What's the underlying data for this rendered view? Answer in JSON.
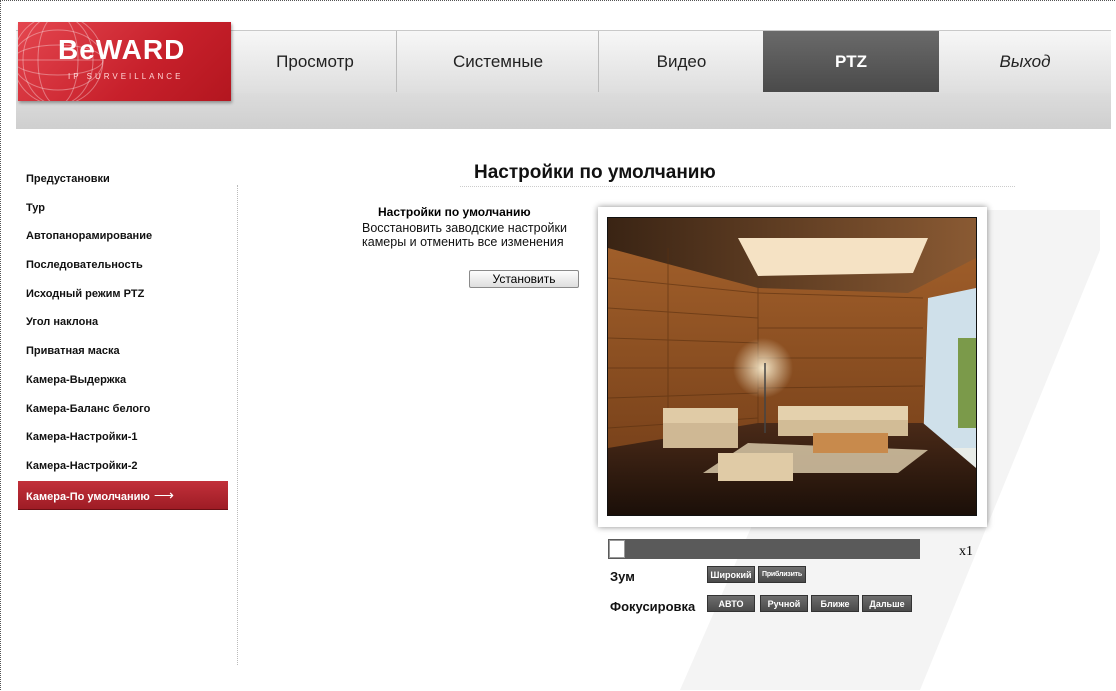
{
  "logo": {
    "brand": "BeWARD",
    "tagline": "IP SURVEILLANCE"
  },
  "nav": [
    {
      "label": "Просмотр"
    },
    {
      "label": "Системные"
    },
    {
      "label": "Видео"
    },
    {
      "label": "PTZ",
      "active": true
    },
    {
      "label": "Выход"
    }
  ],
  "sidebar": {
    "items": [
      {
        "label": "Предустановки"
      },
      {
        "label": "Тур"
      },
      {
        "label": "Автопанорамирование"
      },
      {
        "label": "Последовательность"
      },
      {
        "label": "Исходный режим PTZ"
      },
      {
        "label": "Угол наклона"
      },
      {
        "label": "Приватная маска"
      },
      {
        "label": "Камера-Выдержка"
      },
      {
        "label": "Камера-Баланс белого"
      },
      {
        "label": "Камера-Настройки-1"
      },
      {
        "label": "Камера-Настройки-2"
      },
      {
        "label": "Камера-По умолчанию",
        "active": true,
        "arrow": "⟶"
      }
    ]
  },
  "main": {
    "page_title": "Настройки по умолчанию",
    "section_title": "Настройки по умолчанию",
    "section_desc": "Восстановить заводские настройки камеры и отменить все изменения",
    "set_button": "Установить"
  },
  "controls": {
    "zoom_level": "x1",
    "zoom_value": 0,
    "zoom_label": "Зум",
    "zoom_wide": "Широкий",
    "zoom_tele": "Приблизить",
    "focus_label": "Фокусировка",
    "focus_auto": "АВТО",
    "focus_manual": "Ручной",
    "focus_near": "Ближе",
    "focus_far": "Дальше"
  },
  "colors": {
    "accent_red": "#b3202a",
    "active_tab": "#555555"
  }
}
